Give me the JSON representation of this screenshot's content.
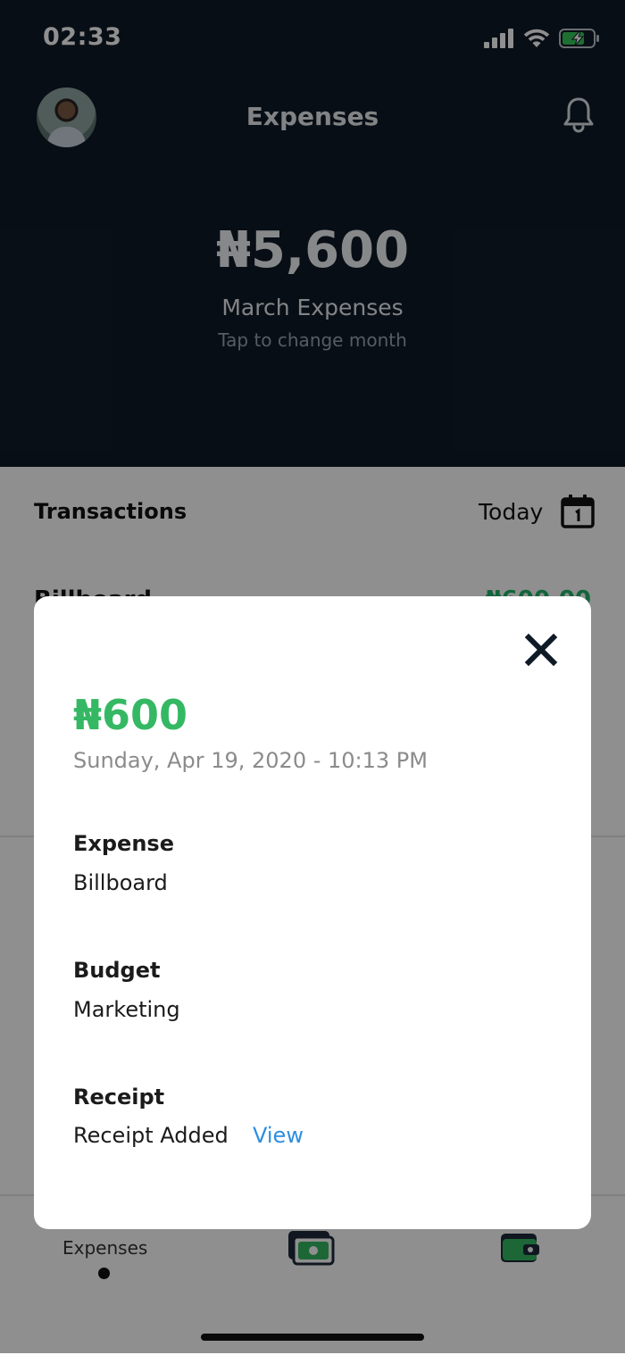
{
  "status_bar": {
    "time": "02:33"
  },
  "header": {
    "title": "Expenses",
    "total": "₦5,600",
    "month_label": "March Expenses",
    "month_hint": "Tap to change month"
  },
  "transactions": {
    "title": "Transactions",
    "filter_label": "Today",
    "rows": [
      {
        "name": "Billboard",
        "amount": "₦600.00"
      }
    ]
  },
  "tabbar": {
    "items": [
      {
        "label": "Expenses",
        "icon": "receipt-icon",
        "active": true
      },
      {
        "label": "",
        "icon": "cash-icon",
        "active": false
      },
      {
        "label": "",
        "icon": "wallet-icon",
        "active": false
      }
    ]
  },
  "modal": {
    "amount": "₦600",
    "date": "Sunday, Apr 19, 2020 - 10:13 PM",
    "fields": [
      {
        "label": "Expense",
        "value": "Billboard"
      },
      {
        "label": "Budget",
        "value": "Marketing"
      },
      {
        "label": "Receipt",
        "value": "Receipt Added"
      }
    ],
    "receipt_link": "View"
  },
  "colors": {
    "header_bg": "#0f1a27",
    "amount_green": "#35b863",
    "link_blue": "#2d8ee0",
    "battery_green": "#34c759"
  }
}
